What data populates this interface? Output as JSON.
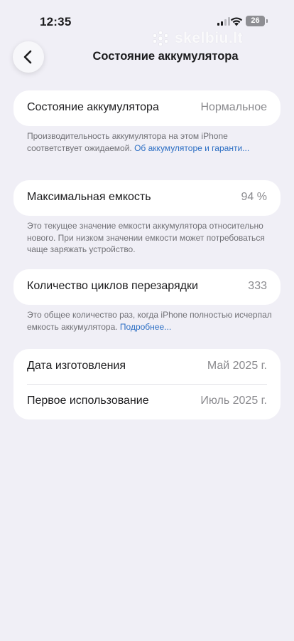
{
  "status_bar": {
    "time": "12:35",
    "battery_level": "26",
    "icons": [
      "cellular-signal-icon",
      "wifi-icon",
      "battery-icon"
    ]
  },
  "watermark": {
    "text": "skelbiu.lt"
  },
  "nav": {
    "title": "Состояние аккумулятора",
    "back_icon": "chevron-left-icon"
  },
  "health": {
    "label": "Состояние аккумулятора",
    "value": "Нормальное",
    "footnote_text": "Производительность аккумулятора на этом iPhone соответствует ожидаемой. ",
    "footnote_link": "Об аккумуляторе и гаранти..."
  },
  "capacity": {
    "label": "Максимальная емкость",
    "value": "94 %",
    "footnote_text": "Это текущее значение емкости аккумулятора относительно нового. При низком значении емкости может потребоваться чаще заряжать устройство."
  },
  "cycles": {
    "label": "Количество циклов перезарядки",
    "value": "333",
    "footnote_text": "Это общее количество раз, когда iPhone полностью исчерпал емкость аккумулятора. ",
    "footnote_link": "Подробнее..."
  },
  "dates": {
    "manufacture_label": "Дата изготовления",
    "manufacture_value": "Май 2025 г.",
    "first_use_label": "Первое использование",
    "first_use_value": "Июль 2025 г."
  },
  "colors": {
    "background": "#f0eff6",
    "card": "#ffffff",
    "secondary_text": "#8a8a8e",
    "link": "#2d6fc4"
  }
}
